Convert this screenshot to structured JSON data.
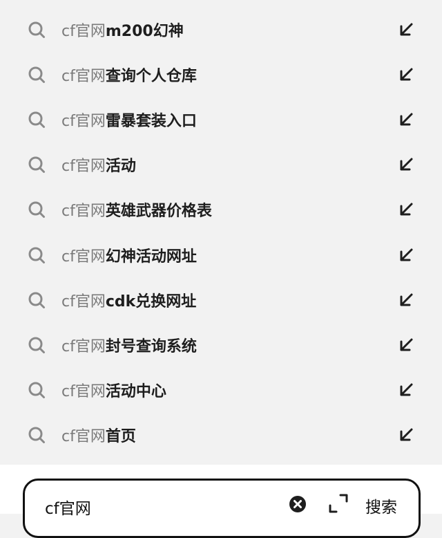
{
  "suggestions": [
    {
      "query": "cf官网",
      "suffix": "m200幻神"
    },
    {
      "query": "cf官网",
      "suffix": "查询个人仓库"
    },
    {
      "query": "cf官网",
      "suffix": "雷暴套装入口"
    },
    {
      "query": "cf官网",
      "suffix": "活动"
    },
    {
      "query": "cf官网",
      "suffix": "英雄武器价格表"
    },
    {
      "query": "cf官网",
      "suffix": "幻神活动网址"
    },
    {
      "query": "cf官网",
      "suffix": "cdk兑换网址"
    },
    {
      "query": "cf官网",
      "suffix": "封号查询系统"
    },
    {
      "query": "cf官网",
      "suffix": "活动中心"
    },
    {
      "query": "cf官网",
      "suffix": "首页"
    }
  ],
  "search": {
    "value": "cf官网",
    "button_label": "搜索"
  },
  "icons": {
    "suggestion_leading": "search-icon",
    "suggestion_trailing": "fill-arrow-icon",
    "clear": "clear-icon",
    "scan": "scan-icon"
  },
  "colors": {
    "background": "#f2f2f2",
    "query_text": "#7a7a7a",
    "suggestion_text": "#1e1e1e",
    "icon": "#8a8a8a"
  }
}
